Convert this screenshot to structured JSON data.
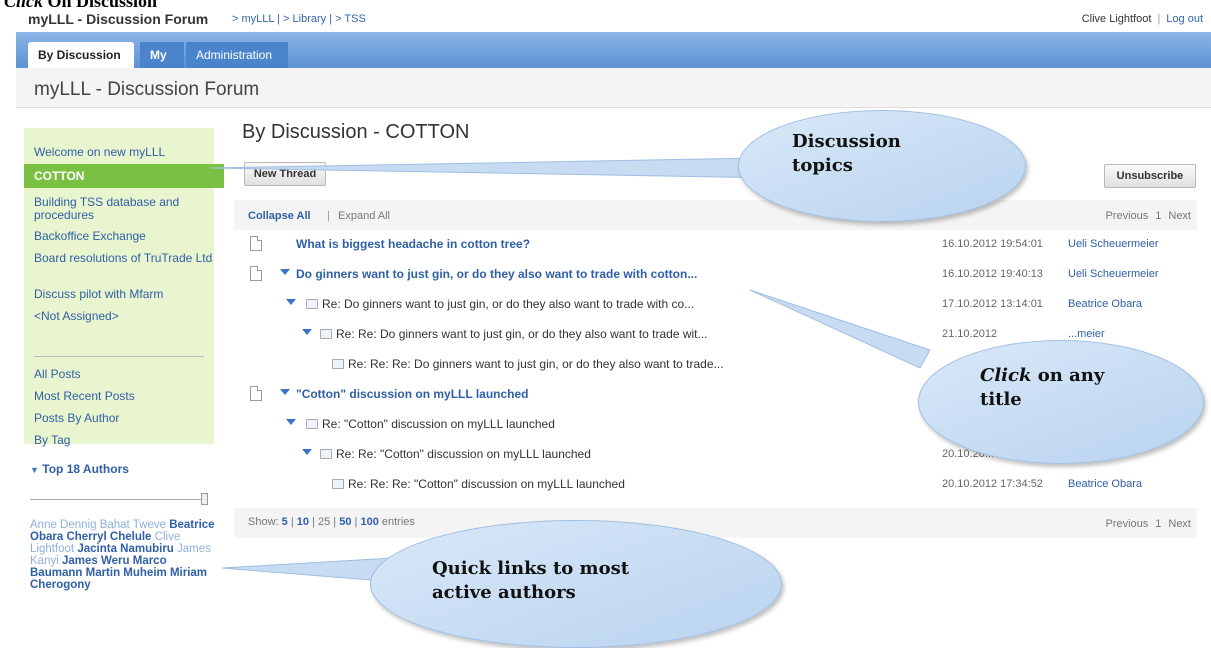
{
  "caption": {
    "verb": "Click",
    "rest": " On Discussion"
  },
  "header": {
    "app_name": "myLLL - Discussion Forum",
    "breadcrumb": "> myLLL | > Library | > TSS",
    "user": "Clive Lightfoot",
    "separator": "|",
    "logout": "Log out"
  },
  "tabs": [
    {
      "label": "By Discussion"
    },
    {
      "label": "My"
    },
    {
      "label": "Administration"
    }
  ],
  "forum_title": "myLLL - Discussion Forum",
  "sidebar": {
    "topics": [
      {
        "label": "Welcome on new myLLL"
      },
      {
        "label": "COTTON"
      },
      {
        "label": "Building TSS database and procedures"
      },
      {
        "label": "Backoffice Exchange"
      },
      {
        "label": "Board resolutions of TruTrade Ltd"
      },
      {
        "label": "Discuss pilot with Mfarm"
      },
      {
        "label": "<Not Assigned>"
      }
    ],
    "views": [
      {
        "label": "All Posts"
      },
      {
        "label": "Most Recent Posts"
      },
      {
        "label": "Posts By Author"
      },
      {
        "label": "By Tag"
      }
    ],
    "authors_heading": "Top 18 Authors",
    "authors": [
      {
        "name": "Anne Dennig",
        "weight": "light"
      },
      {
        "name": "Bahat Tweve",
        "weight": "light"
      },
      {
        "name": "Beatrice Obara",
        "weight": "bold"
      },
      {
        "name": "Cherryl Chelule",
        "weight": "bold"
      },
      {
        "name": "Clive Lightfoot",
        "weight": "light"
      },
      {
        "name": "Jacinta Namubiru",
        "weight": "bold"
      },
      {
        "name": "James Kanyi",
        "weight": "light"
      },
      {
        "name": "James Weru",
        "weight": "bold"
      },
      {
        "name": "Marco Baumann",
        "weight": "bold"
      },
      {
        "name": "Martin Muheim",
        "weight": "bold"
      },
      {
        "name": "Miriam Cherogony",
        "weight": "bold"
      }
    ]
  },
  "main": {
    "title": "By Discussion - COTTON",
    "new_thread": "New Thread",
    "unsubscribe": "Unsubscribe",
    "collapse_all": "Collapse All",
    "pipe": "|",
    "expand_all": "Expand All",
    "pager": {
      "previous": "Previous",
      "page": "1",
      "next": "Next"
    },
    "threads": [
      {
        "title": "What is biggest headache in cotton tree?",
        "date": "16.10.2012 19:54:01",
        "author": "Ueli Scheuermeier"
      },
      {
        "title": "Do ginners want to just gin, or do they also want to trade with cotton...",
        "date": "16.10.2012 19:40:13",
        "author": "Ueli Scheuermeier"
      },
      {
        "title": "Re: Do ginners want to just gin, or do they also want to trade with co...",
        "date": "17.10.2012 13:14:01",
        "author": "Beatrice Obara"
      },
      {
        "title": "Re: Re: Do ginners want to just gin, or do they also want to trade wit...",
        "date": "21.10.2012",
        "author": "...meier"
      },
      {
        "title": "Re: Re: Re: Do ginners want to just gin, or do they also want to trade...",
        "date": "",
        "author": ""
      },
      {
        "title": "\"Cotton\" discussion on myLLL launched",
        "date": "",
        "author": ""
      },
      {
        "title": "Re: \"Cotton\" discussion on myLLL launched",
        "date": "",
        "author": ""
      },
      {
        "title": "Re: Re: \"Cotton\" discussion on myLLL launched",
        "date": "20.10.20...",
        "author": ""
      },
      {
        "title": "Re: Re: Re: \"Cotton\" discussion on myLLL launched",
        "date": "20.10.2012 17:34:52",
        "author": "Beatrice Obara"
      }
    ],
    "show_entries": {
      "label": "Show:",
      "options": [
        "5",
        "10",
        "25",
        "50",
        "100"
      ],
      "suffix": "entries"
    }
  },
  "callouts": {
    "topics": [
      "Discussion",
      "topics"
    ],
    "click_title": {
      "verb": "Click",
      "rest": " on any",
      "line2": "title"
    },
    "authors": [
      "Quick links to most",
      "active authors"
    ]
  }
}
